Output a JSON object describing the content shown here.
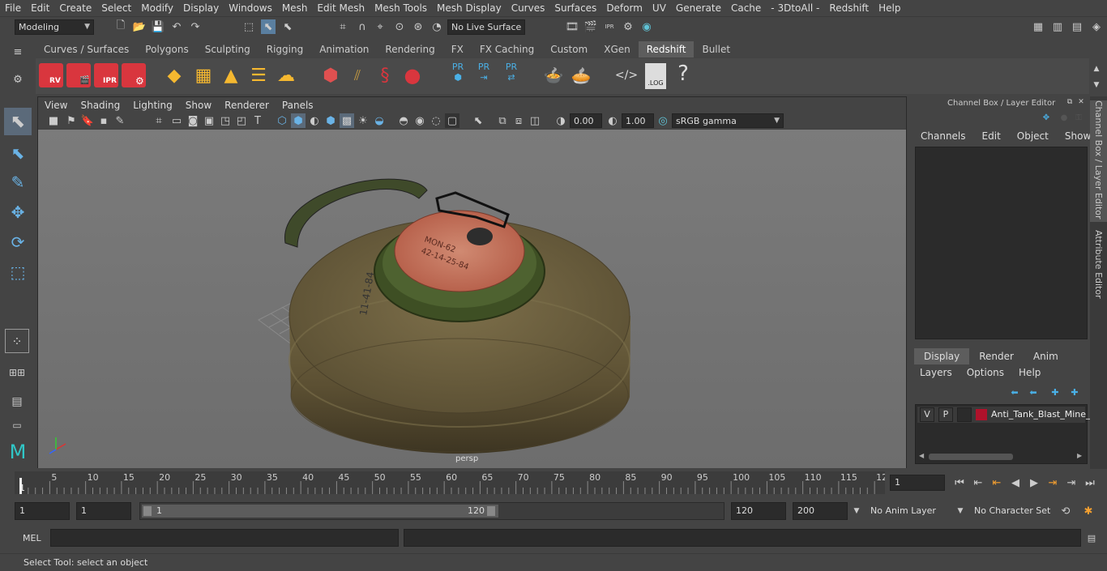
{
  "menubar": [
    "File",
    "Edit",
    "Create",
    "Select",
    "Modify",
    "Display",
    "Windows",
    "Mesh",
    "Edit Mesh",
    "Mesh Tools",
    "Mesh Display",
    "Curves",
    "Surfaces",
    "Deform",
    "UV",
    "Generate",
    "Cache",
    "- 3DtoAll -",
    "Redshift",
    "Help"
  ],
  "status": {
    "mode": "Modeling",
    "live_surface": "No Live Surface"
  },
  "shelf": {
    "tabs": [
      "Curves / Surfaces",
      "Polygons",
      "Sculpting",
      "Rigging",
      "Animation",
      "Rendering",
      "FX",
      "FX Caching",
      "Custom",
      "XGen",
      "Redshift",
      "Bullet"
    ],
    "active": "Redshift",
    "labels": {
      "rv": "RV",
      "ipr": "IPR",
      "pr1": "PR",
      "pr2": "PR",
      "pr3": "PR",
      "log": ".LOG",
      "help": "?"
    }
  },
  "viewport": {
    "menu": [
      "View",
      "Shading",
      "Lighting",
      "Show",
      "Renderer",
      "Panels"
    ],
    "exposure": "0.00",
    "gamma": "1.00",
    "colorspace": "sRGB gamma",
    "camera": "persp",
    "decal1": "11-41-84",
    "decal2": "MON-62",
    "decal3": "42-14-25-84"
  },
  "channelbox": {
    "title": "Channel Box / Layer Editor",
    "menu": [
      "Channels",
      "Edit",
      "Object",
      "Show"
    ],
    "tabs": [
      "Display",
      "Render",
      "Anim"
    ],
    "active_tab": "Display",
    "layer_menu": [
      "Layers",
      "Options",
      "Help"
    ],
    "layer": {
      "v": "V",
      "p": "P",
      "name": "Anti_Tank_Blast_Mine_",
      "color": "#b0122b"
    }
  },
  "sidetabs": {
    "tab1": "Channel Box / Layer Editor",
    "tab2": "Attribute Editor"
  },
  "timeline": {
    "ticks": [
      "5",
      "10",
      "15",
      "20",
      "25",
      "30",
      "35",
      "40",
      "45",
      "50",
      "55",
      "60",
      "65",
      "70",
      "75",
      "80",
      "85",
      "90",
      "95",
      "100",
      "105",
      "110",
      "115",
      "12"
    ],
    "start_tick": "1",
    "current_frame": "1"
  },
  "range": {
    "start": "1",
    "playback_start": "1",
    "slider_start": "1",
    "slider_end": "120",
    "end": "120",
    "max": "200",
    "anim_layer": "No Anim Layer",
    "character_set": "No Character Set"
  },
  "cmd": {
    "label": "MEL"
  },
  "help": {
    "text": "Select Tool: select an object"
  }
}
